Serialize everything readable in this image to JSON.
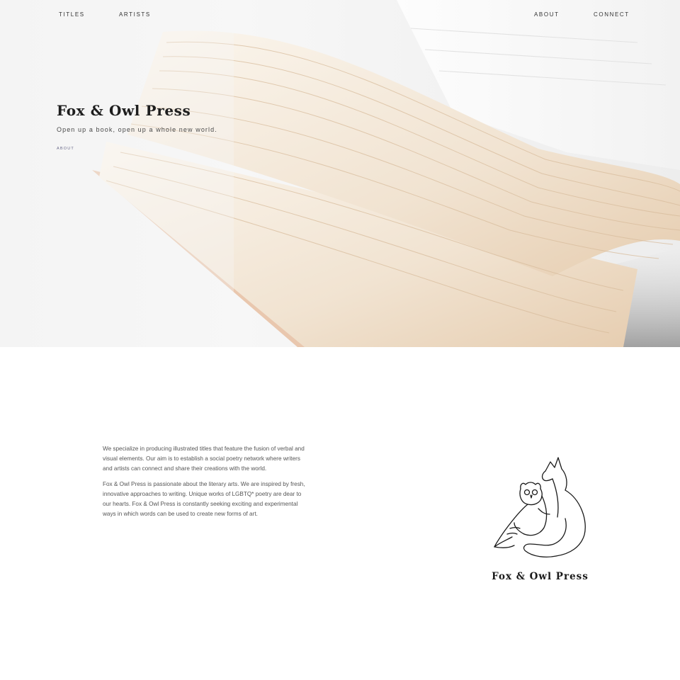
{
  "nav": {
    "titles": "TITLES",
    "artists": "ARTISTS",
    "about": "ABOUT",
    "connect": "CONNECT"
  },
  "hero": {
    "title": "Fox & Owl Press",
    "tagline": "Open up a book, open up a whole new world.",
    "link_label": "ABOUT"
  },
  "about": {
    "paragraphs": [
      "We specialize in producing illustrated titles that feature the fusion of verbal and visual elements. Our aim is to establish a social poetry network where writers and artists can connect and share their creations with the world.",
      "Fox & Owl Press is passionate about the literary arts. We are inspired by fresh, innovative approaches to writing. Unique works of LGBTQ* poetry are dear to our hearts. Fox & Owl Press is constantly seeking exciting and experimental ways in which words can be used to create new forms of art."
    ]
  },
  "logo": {
    "name": "Fox & Owl Press",
    "icon": "fox-and-owl-line-drawing"
  },
  "colors": {
    "text": "#333333",
    "link_accent": "#6a6a8a",
    "page_background": "#ffffff"
  }
}
